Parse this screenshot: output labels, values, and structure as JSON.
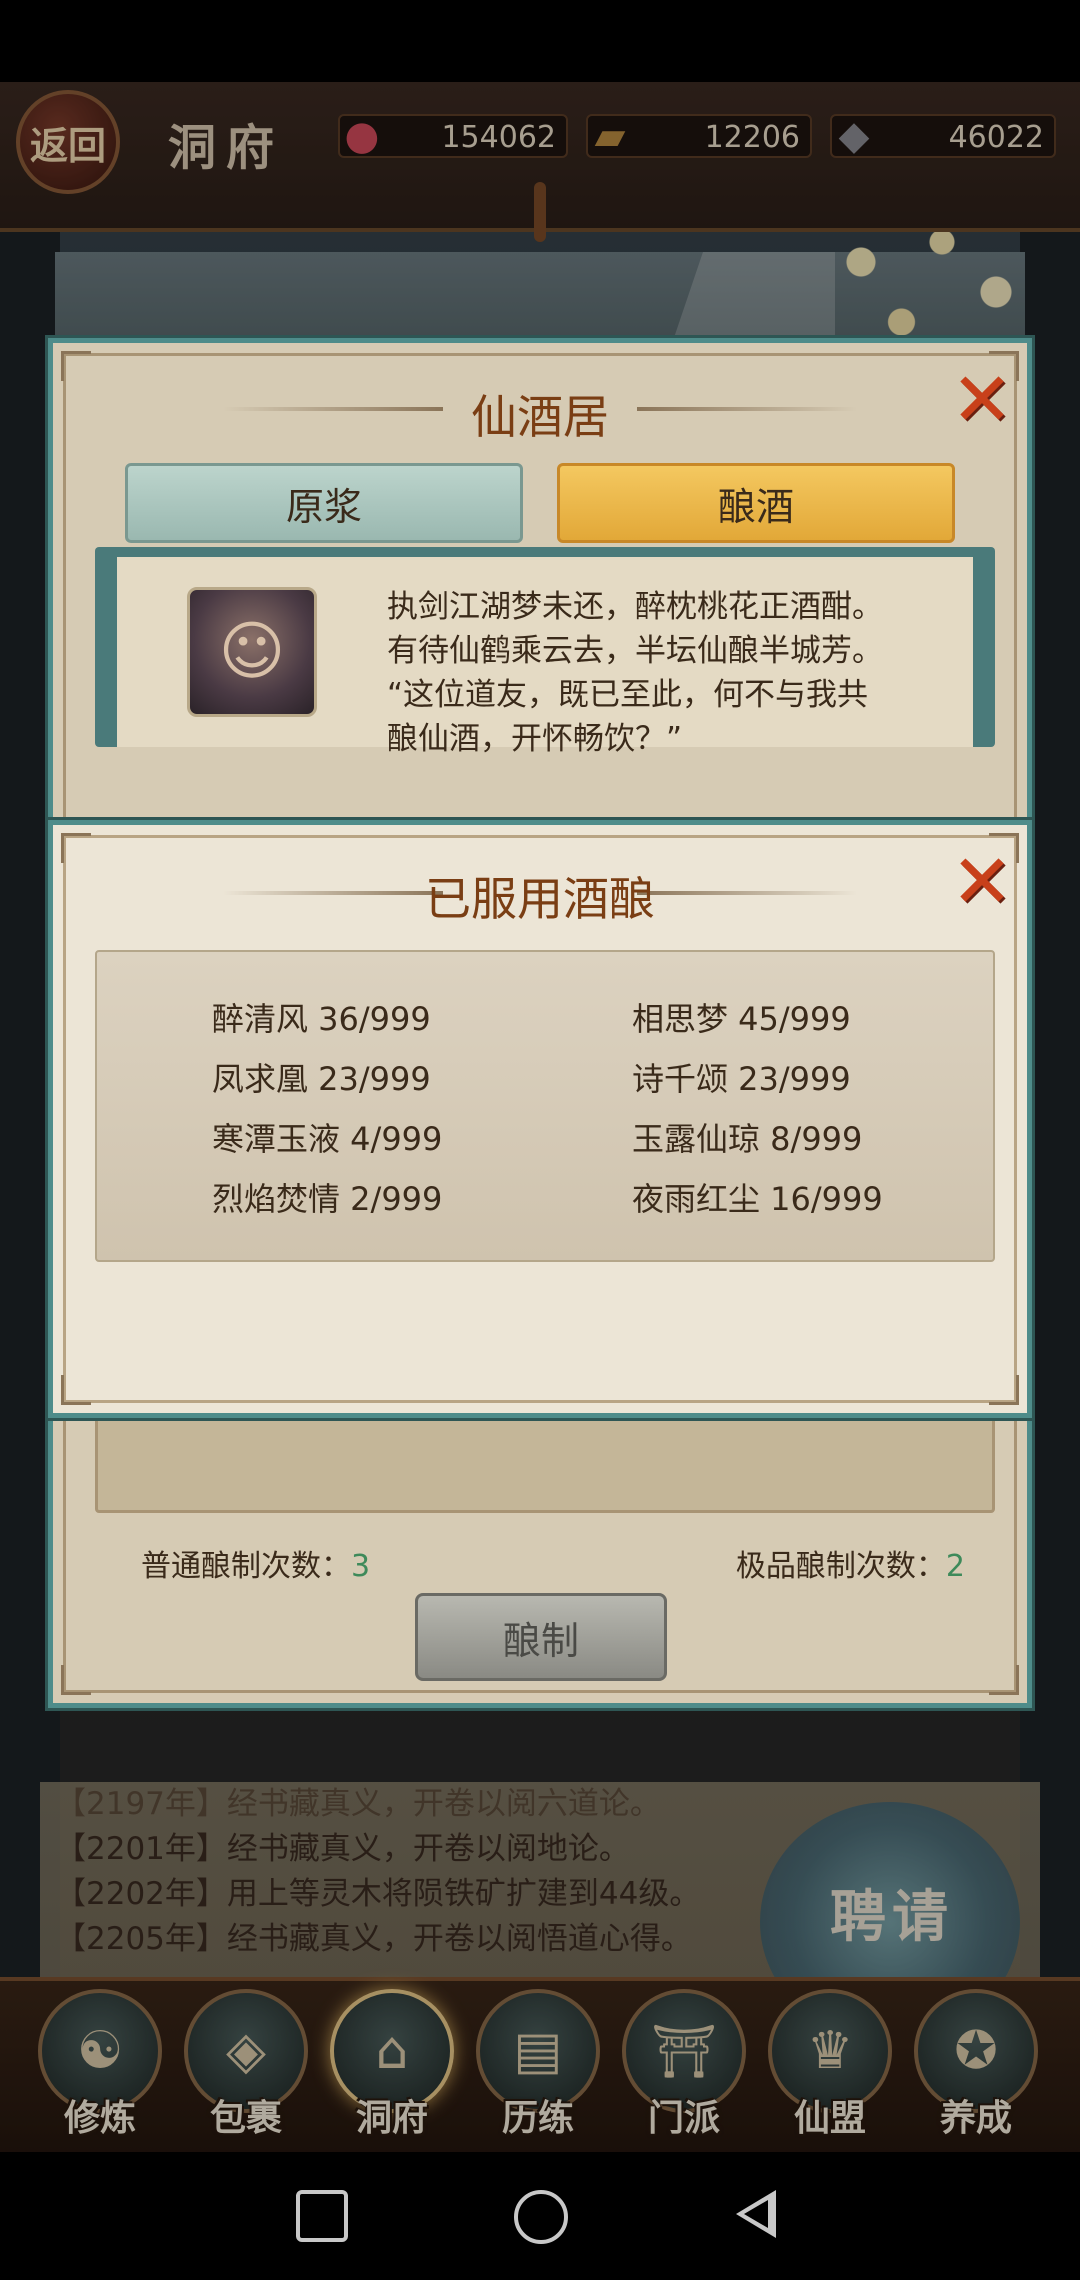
{
  "topbar": {
    "back_label": "返回",
    "title": "洞府",
    "resources": [
      {
        "icon": "meat-icon",
        "value": "154062"
      },
      {
        "icon": "wood-icon",
        "value": "12206"
      },
      {
        "icon": "ore-icon",
        "value": "46022"
      }
    ]
  },
  "tavern": {
    "title": "仙酒居",
    "tabs": [
      "原浆",
      "酿酒"
    ],
    "active_tab": "酿酒",
    "intro_lines": [
      "执剑江湖梦未还，醉枕桃花正酒酣。",
      "有待仙鹤乘云去，半坛仙酿半城芳。",
      "“这位道友，既已至此，何不与我共",
      "酿仙酒，开怀畅饮？”"
    ],
    "normal_count_label": "普通酿制次数：",
    "normal_count_value": "3",
    "premium_count_label": "极品酿制次数：",
    "premium_count_value": "2",
    "brew_button": "酿制"
  },
  "dialog": {
    "title": "已服用酒酿",
    "items": [
      "醉清风 36/999",
      "相思梦 45/999",
      "凤求凰 23/999",
      "诗千颂 23/999",
      "寒潭玉液 4/999",
      "玉露仙琼 8/999",
      "烈焰焚情 2/999",
      "夜雨红尘 16/999"
    ]
  },
  "log": {
    "lines": [
      "【2197年】经书藏真义，开卷以阅六道论。",
      "【2201年】经书藏真义，开卷以阅地论。",
      "【2202年】用上等灵木将陨铁矿扩建到44级。",
      "【2205年】经书藏真义，开卷以阅悟道心得。"
    ]
  },
  "hire_label": "聘请",
  "nav": {
    "items": [
      "修炼",
      "包裹",
      "洞府",
      "历练",
      "门派",
      "仙盟",
      "养成"
    ],
    "active": "洞府"
  },
  "colors": {
    "accent_teal": "#4e8c8a",
    "title_brown": "#7a3e14",
    "close_red": "#c8401a",
    "count_green": "#3e8a5a"
  }
}
